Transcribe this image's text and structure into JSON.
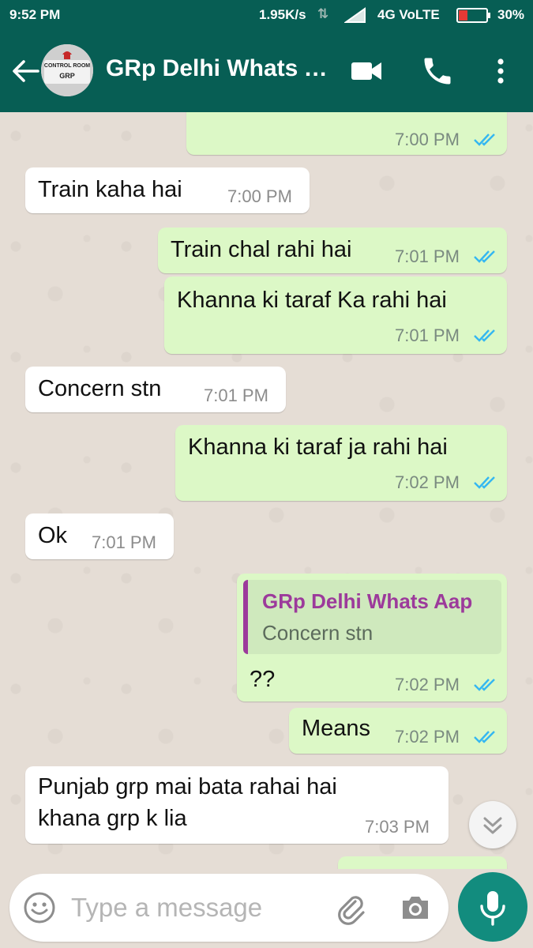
{
  "status_bar": {
    "time": "9:52 PM",
    "speed": "1.95K/s",
    "network": "4G VoLTE",
    "battery": "30%"
  },
  "header": {
    "title": "GRp Delhi Whats Aap",
    "avatar_text_top": "CONTROL ROOM",
    "avatar_text_bottom": "GRP",
    "icons": [
      "back-arrow-icon",
      "video-call-icon",
      "phone-icon",
      "more-vert-icon"
    ]
  },
  "messages": [
    {
      "dir": "out",
      "text": "",
      "time": "7:00 PM",
      "ticks": "read"
    },
    {
      "dir": "in",
      "text": "Train kaha hai",
      "time": "7:00 PM"
    },
    {
      "dir": "out",
      "text": "Train chal rahi hai",
      "time": "7:01 PM",
      "ticks": "read"
    },
    {
      "dir": "out",
      "text": "Khanna ki taraf Ka rahi hai",
      "time": "7:01 PM",
      "ticks": "read"
    },
    {
      "dir": "in",
      "text": "Concern stn",
      "time": "7:01 PM"
    },
    {
      "dir": "out",
      "text": "Khanna ki taraf ja rahi hai",
      "time": "7:02 PM",
      "ticks": "read"
    },
    {
      "dir": "in",
      "text": "Ok",
      "time": "7:01 PM"
    },
    {
      "dir": "out",
      "quote": {
        "name": "GRp Delhi Whats Aap",
        "text": "Concern stn"
      },
      "text": "??",
      "time": "7:02 PM",
      "ticks": "read"
    },
    {
      "dir": "out",
      "text": "Means",
      "time": "7:02 PM",
      "ticks": "read"
    },
    {
      "dir": "in",
      "text_lines": [
        "Punjab grp mai bata rahai hai",
        "khana grp k lia"
      ],
      "time": "7:03 PM"
    }
  ],
  "composer": {
    "placeholder": "Type a message",
    "icons": [
      "emoji-icon",
      "attach-icon",
      "camera-icon",
      "mic-icon"
    ]
  },
  "colors": {
    "header": "#075e54",
    "outgoing_bubble": "#dcf8c6",
    "incoming_bubble": "#ffffff",
    "read_ticks": "#34b7f1",
    "mic_button": "#128c7e",
    "quote_accent": "#9c3a9b"
  }
}
